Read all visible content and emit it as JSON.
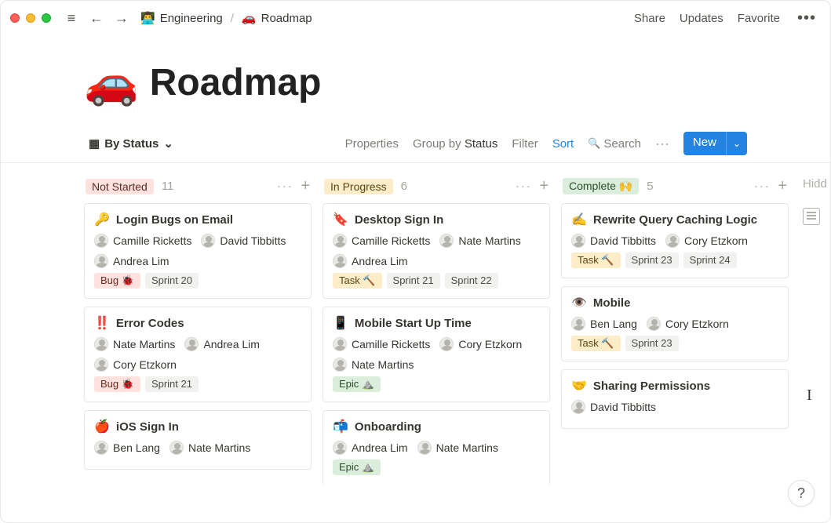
{
  "topbar": {
    "back": "←",
    "forward": "→",
    "menu": "≡",
    "crumb1_icon": "👨‍💻",
    "crumb1": "Engineering",
    "sep": "/",
    "crumb2_icon": "🚗",
    "crumb2": "Roadmap",
    "share": "Share",
    "updates": "Updates",
    "favorite": "Favorite",
    "more": "•••"
  },
  "page": {
    "emoji": "🚗",
    "title": "Roadmap"
  },
  "viewbar": {
    "icon": "▦",
    "label": "By Status",
    "chev": "⌄",
    "properties": "Properties",
    "groupby_prefix": "Group by",
    "groupby_value": "Status",
    "filter": "Filter",
    "sort": "Sort",
    "search_icon": "🔍",
    "search": "Search",
    "dots": "···",
    "new": "New",
    "new_chev": "⌄"
  },
  "board": {
    "columns": [
      {
        "tag": "Not Started",
        "tagClass": "tag-notstarted",
        "count": "11",
        "cards": [
          {
            "icon": "🔑",
            "title": "Login Bugs on Email",
            "people": [
              "Camille Ricketts",
              "David Tibbitts",
              "Andrea Lim"
            ],
            "chips": [
              {
                "text": "Bug 🐞",
                "cls": "bug"
              },
              {
                "text": "Sprint 20",
                "cls": ""
              }
            ]
          },
          {
            "icon": "‼️",
            "title": "Error Codes",
            "people": [
              "Nate Martins",
              "Andrea Lim",
              "Cory Etzkorn"
            ],
            "chips": [
              {
                "text": "Bug 🐞",
                "cls": "bug"
              },
              {
                "text": "Sprint 21",
                "cls": ""
              }
            ]
          },
          {
            "icon": "🍎",
            "title": "iOS Sign In",
            "people": [
              "Ben Lang",
              "Nate Martins"
            ],
            "chips": []
          }
        ]
      },
      {
        "tag": "In Progress",
        "tagClass": "tag-inprogress",
        "count": "6",
        "cards": [
          {
            "icon": "🔖",
            "title": "Desktop Sign In",
            "people": [
              "Camille Ricketts",
              "Nate Martins",
              "Andrea Lim"
            ],
            "chips": [
              {
                "text": "Task 🔨",
                "cls": "task"
              },
              {
                "text": "Sprint 21",
                "cls": ""
              },
              {
                "text": "Sprint 22",
                "cls": ""
              }
            ]
          },
          {
            "icon": "📱",
            "title": "Mobile Start Up Time",
            "people": [
              "Camille Ricketts",
              "Cory Etzkorn",
              "Nate Martins"
            ],
            "chips": [
              {
                "text": "Epic ⛰️",
                "cls": "epic"
              }
            ]
          },
          {
            "icon": "📬",
            "title": "Onboarding",
            "people": [
              "Andrea Lim",
              "Nate Martins"
            ],
            "chips": [
              {
                "text": "Epic ⛰️",
                "cls": "epic"
              }
            ]
          }
        ]
      },
      {
        "tag": "Complete 🙌",
        "tagClass": "tag-complete",
        "count": "5",
        "cards": [
          {
            "icon": "✍️",
            "title": "Rewrite Query Caching Logic",
            "people": [
              "David Tibbitts",
              "Cory Etzkorn"
            ],
            "chips": [
              {
                "text": "Task 🔨",
                "cls": "task"
              },
              {
                "text": "Sprint 23",
                "cls": ""
              },
              {
                "text": "Sprint 24",
                "cls": ""
              }
            ]
          },
          {
            "icon": "👁️",
            "title": "Mobile",
            "people": [
              "Ben Lang",
              "Cory Etzkorn"
            ],
            "chips": [
              {
                "text": "Task 🔨",
                "cls": "task"
              },
              {
                "text": "Sprint 23",
                "cls": ""
              }
            ]
          },
          {
            "icon": "🤝",
            "title": "Sharing Permissions",
            "people": [
              "David Tibbitts"
            ],
            "chips": []
          }
        ]
      }
    ],
    "hidden_label": "Hidd"
  },
  "help": "?"
}
